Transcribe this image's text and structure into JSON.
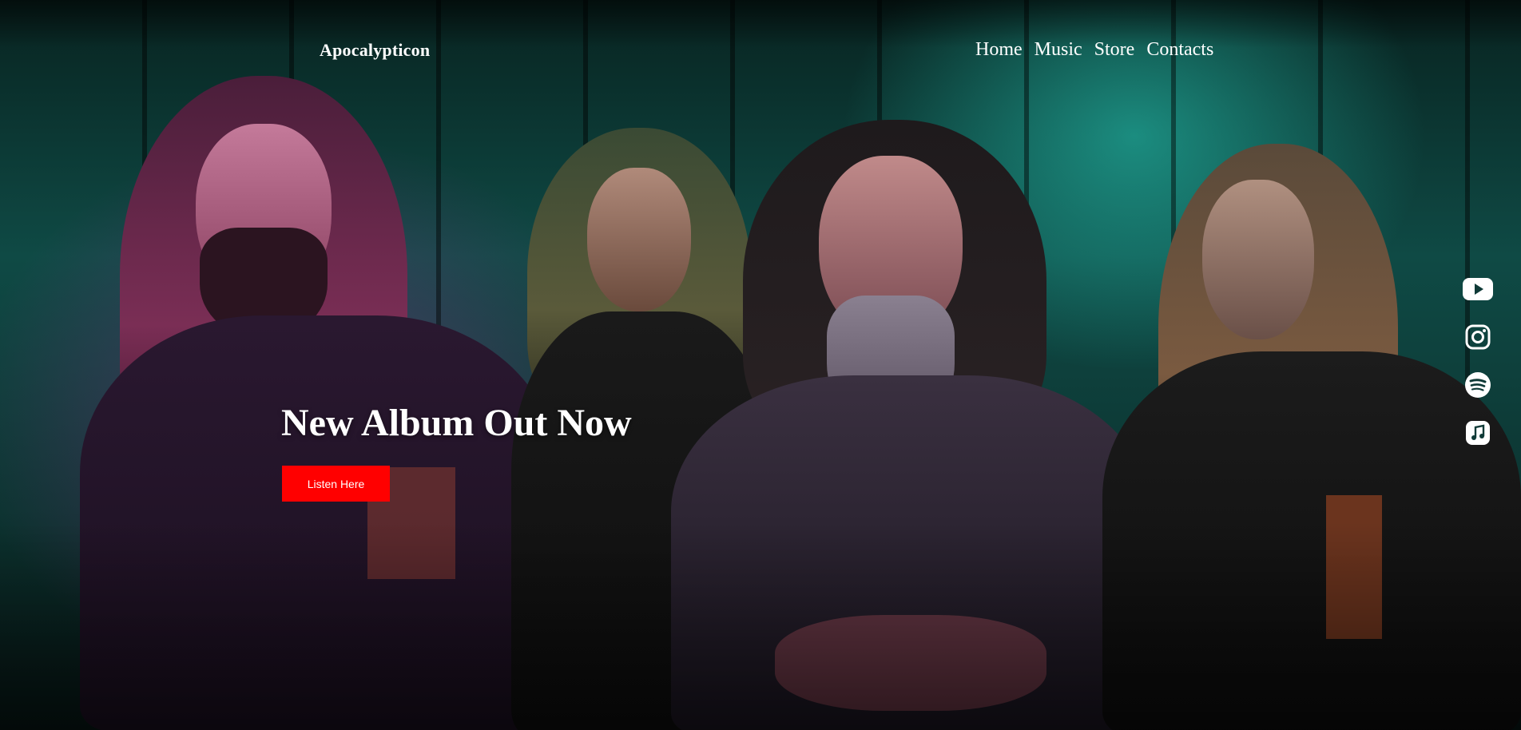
{
  "header": {
    "brand": "Apocalypticon",
    "nav": [
      {
        "label": "Home"
      },
      {
        "label": "Music"
      },
      {
        "label": "Store"
      },
      {
        "label": "Contacts"
      }
    ]
  },
  "hero": {
    "headline": "New Album Out Now",
    "cta_label": "Listen Here",
    "cta_color": "#ff0000",
    "background_image": "band-photo"
  },
  "social": [
    {
      "icon": "youtube-icon"
    },
    {
      "icon": "instagram-icon"
    },
    {
      "icon": "spotify-icon"
    },
    {
      "icon": "apple-music-icon"
    }
  ]
}
